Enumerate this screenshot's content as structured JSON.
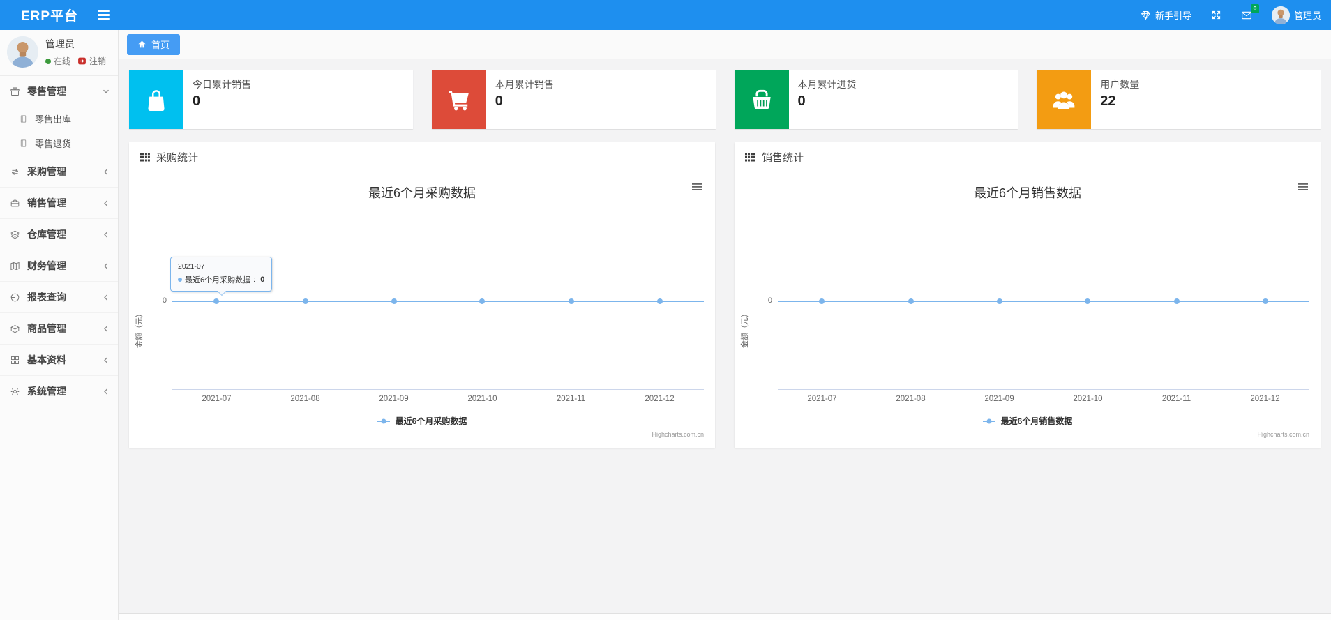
{
  "navbar": {
    "brand": "ERP平台",
    "guide_label": "新手引导",
    "mail_badge": "0",
    "username": "管理员"
  },
  "sidebar": {
    "user": {
      "name": "管理员",
      "status_online": "在线",
      "logout_label": "注销"
    },
    "items": [
      {
        "label": "零售管理",
        "icon": "gift-icon",
        "state": "expanded",
        "children": [
          {
            "label": "零售出库",
            "icon": "file-icon"
          },
          {
            "label": "零售退货",
            "icon": "file-icon"
          }
        ]
      },
      {
        "label": "采购管理",
        "icon": "repeat-icon"
      },
      {
        "label": "销售管理",
        "icon": "briefcase-icon"
      },
      {
        "label": "仓库管理",
        "icon": "layers-icon"
      },
      {
        "label": "财务管理",
        "icon": "book-icon"
      },
      {
        "label": "报表查询",
        "icon": "pie-chart-icon"
      },
      {
        "label": "商品管理",
        "icon": "box-icon"
      },
      {
        "label": "基本资料",
        "icon": "grid-icon"
      },
      {
        "label": "系统管理",
        "icon": "gear-icon"
      }
    ]
  },
  "breadcrumb": {
    "home_tab": "首页"
  },
  "stat_cards": [
    {
      "label": "今日累计销售",
      "value": "0",
      "color": "#00c0ef",
      "icon": "shopping-bag-icon"
    },
    {
      "label": "本月累计销售",
      "value": "0",
      "color": "#dd4b39",
      "icon": "shopping-cart-icon"
    },
    {
      "label": "本月累计进货",
      "value": "0",
      "color": "#00a65a",
      "icon": "basket-icon"
    },
    {
      "label": "用户数量",
      "value": "22",
      "color": "#f39c12",
      "icon": "users-icon"
    }
  ],
  "panels": [
    {
      "title": "采购统计"
    },
    {
      "title": "销售统计"
    }
  ],
  "chart_data": [
    {
      "type": "line",
      "title": "最近6个月采购数据",
      "categories": [
        "2021-07",
        "2021-08",
        "2021-09",
        "2021-10",
        "2021-11",
        "2021-12"
      ],
      "series": [
        {
          "name": "最近6个月采购数据",
          "values": [
            0,
            0,
            0,
            0,
            0,
            0
          ],
          "color": "#7cb5ec"
        }
      ],
      "ylabel": "金额（元）",
      "yticks": [
        "0"
      ],
      "legend_position": "bottom-center",
      "grid": true,
      "credit": "Highcharts.com.cn",
      "tooltip": {
        "category": "2021-07",
        "series_name": "最近6个月采购数据",
        "value": "0"
      }
    },
    {
      "type": "line",
      "title": "最近6个月销售数据",
      "categories": [
        "2021-07",
        "2021-08",
        "2021-09",
        "2021-10",
        "2021-11",
        "2021-12"
      ],
      "series": [
        {
          "name": "最近6个月销售数据",
          "values": [
            0,
            0,
            0,
            0,
            0,
            0
          ],
          "color": "#7cb5ec"
        }
      ],
      "ylabel": "金额（元）",
      "yticks": [
        "0"
      ],
      "legend_position": "bottom-center",
      "grid": true,
      "credit": "Highcharts.com.cn"
    }
  ],
  "colors": {
    "navbar_blue": "#1e8fef",
    "tab_blue": "#459cf4",
    "badge_green": "#00a65a",
    "online_green": "#3c9a3c",
    "logout_red": "#c9302c",
    "series_blue": "#7cb5ec"
  }
}
